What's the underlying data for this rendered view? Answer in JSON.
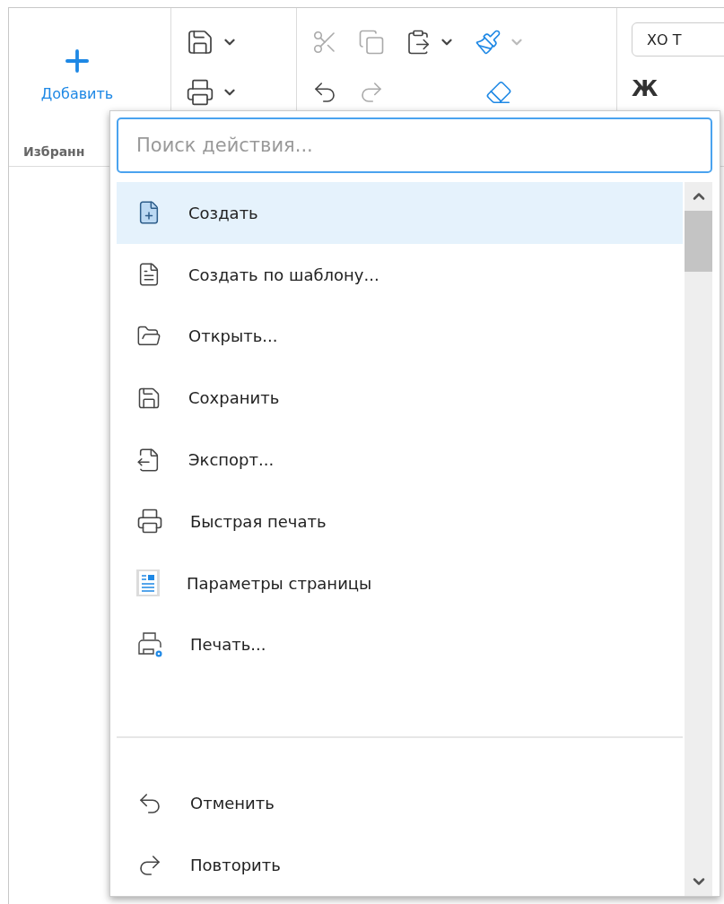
{
  "ribbon": {
    "add_label": "Добавить",
    "favorites_label": "Избранн",
    "font_field": "ХО Т",
    "bold_label": "Ж"
  },
  "action_search": {
    "placeholder": "Поиск действия..."
  },
  "actions": [
    {
      "label": "Создать",
      "selected": true
    },
    {
      "label": "Создать по шаблону...",
      "selected": false
    },
    {
      "label": "Открыть...",
      "selected": false
    },
    {
      "label": "Сохранить",
      "selected": false
    },
    {
      "label": "Экспорт...",
      "selected": false
    },
    {
      "label": "Быстрая печать",
      "selected": false
    },
    {
      "label": "Параметры страницы",
      "selected": false
    },
    {
      "label": "Печать...",
      "selected": false
    }
  ],
  "edit_actions": [
    {
      "label": "Отменить",
      "selected": false
    },
    {
      "label": "Повторить",
      "selected": false
    }
  ]
}
